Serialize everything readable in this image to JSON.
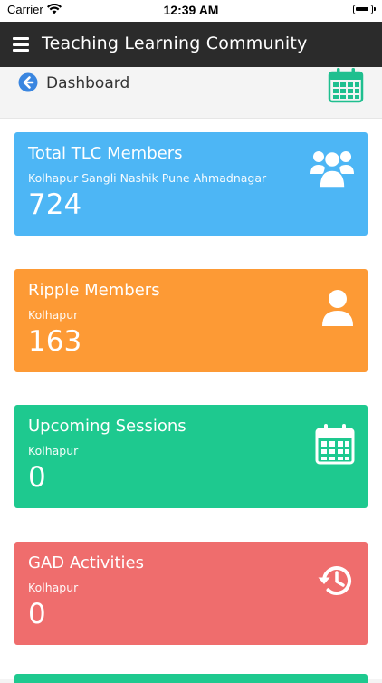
{
  "status_bar": {
    "carrier": "Carrier",
    "time": "12:39 AM"
  },
  "app_bar": {
    "title": "Teaching Learning Community",
    "menu_icon": "hamburger-menu-icon"
  },
  "dashboard": {
    "title": "Dashboard",
    "back_icon": "back-arrow-circle-icon",
    "calendar_icon": "calendar-icon",
    "accent": "#1fbf8f"
  },
  "cards": [
    {
      "title": "Total TLC Members",
      "subtitle": "Kolhapur Sangli Nashik Pune Ahmadnagar",
      "count": "724",
      "color": "#4db6f5",
      "icon": "users-group-icon"
    },
    {
      "title": "Ripple Members",
      "subtitle": "Kolhapur",
      "count": "163",
      "color": "#fd9a35",
      "icon": "user-icon"
    },
    {
      "title": "Upcoming Sessions",
      "subtitle": "Kolhapur",
      "count": "0",
      "color": "#1ec98f",
      "icon": "calendar-icon"
    },
    {
      "title": "GAD Activities",
      "subtitle": "Kolhapur",
      "count": "0",
      "color": "#ef6d6d",
      "icon": "history-icon"
    }
  ],
  "next_card_color": "#1ec98f"
}
